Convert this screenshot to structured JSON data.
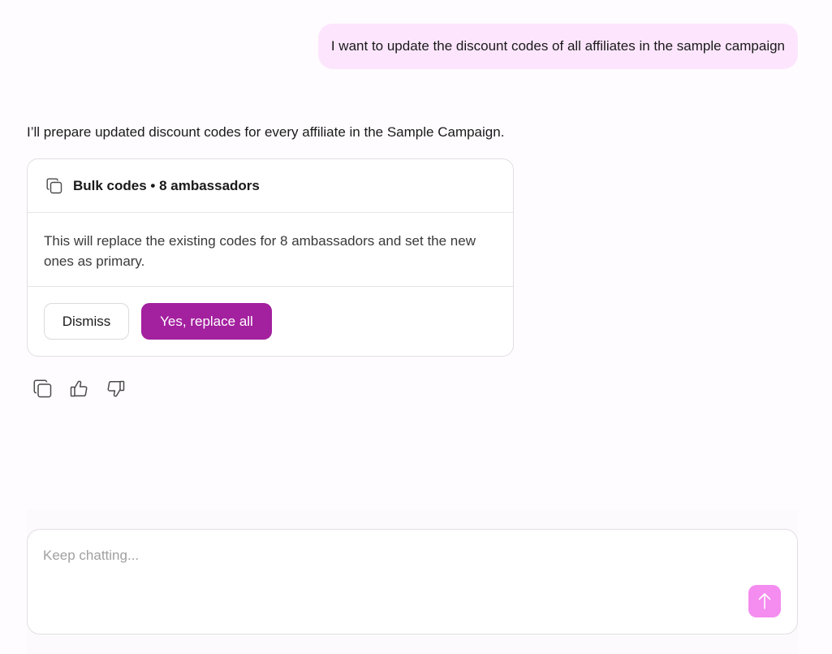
{
  "user_message": {
    "text": "I want to update the discount codes of all affiliates in the sample campaign"
  },
  "assistant": {
    "text": "I’ll prepare updated discount codes for every affiliate in the Sample Campaign.",
    "card": {
      "icon": "copy-icon",
      "title": "Bulk codes • 8 ambassadors",
      "body": "This will replace the existing codes for 8 ambassadors and set the new ones as primary.",
      "dismiss_label": "Dismiss",
      "confirm_label": "Yes, replace all"
    },
    "feedback_icons": [
      "copy-icon",
      "thumbs-up-icon",
      "thumbs-down-icon"
    ]
  },
  "composer": {
    "placeholder": "Keep chatting...",
    "value": "",
    "send_icon": "arrow-up-icon"
  },
  "colors": {
    "user_bubble": "#fde6fd",
    "primary_button": "#a3209f",
    "send_button": "#f58cf0"
  }
}
